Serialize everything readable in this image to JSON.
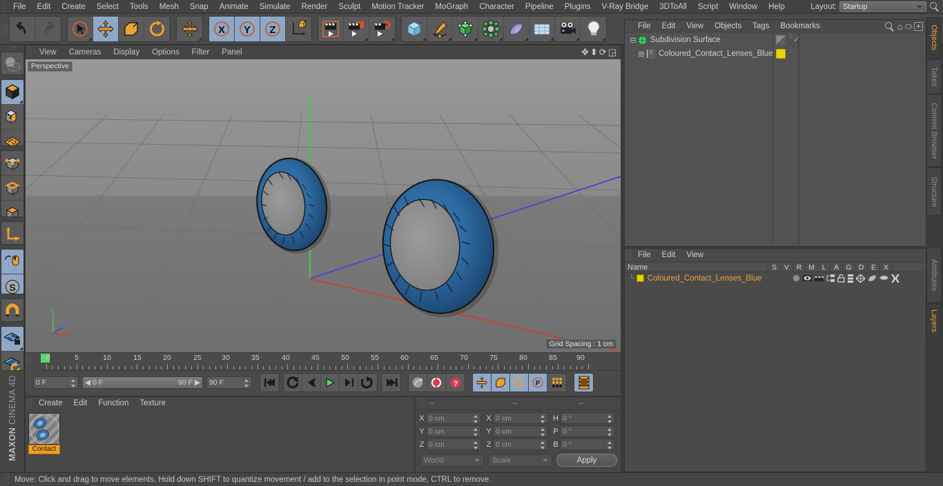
{
  "app": {
    "brand_top": "MAXON",
    "brand_bottom": "CINEMA 4D"
  },
  "menubar": {
    "items": [
      "File",
      "Edit",
      "Create",
      "Select",
      "Tools",
      "Mesh",
      "Snap",
      "Animate",
      "Simulate",
      "Render",
      "Sculpt",
      "Motion Tracker",
      "MoGraph",
      "Character",
      "Pipeline",
      "Plugins",
      "V-Ray Bridge",
      "3DToAll",
      "Script",
      "Window",
      "Help"
    ],
    "layout_label": "Layout:",
    "layout_value": "Startup",
    "search_icon": "search-icon"
  },
  "toolbar": {
    "undo": "undo-icon",
    "redo": "redo-icon",
    "select": "live-selection-icon",
    "move": "move-tool-icon",
    "scale": "scale-tool-icon",
    "rotate": "rotate-tool-icon",
    "move2": "move-axis-icon",
    "x_lock": "X",
    "y_lock": "Y",
    "z_lock": "Z",
    "world_axis": "world-object-axis-icon",
    "render_view": "render-view-icon",
    "render_region": "render-region-icon",
    "render_settings": "render-settings-icon",
    "primitive": "cube-primitive-icon",
    "spline": "pen-spline-icon",
    "generator": "generator-icon",
    "deformer": "deformer-icon",
    "scene_obj": "bend-object-icon",
    "floor": "floor-icon",
    "camera": "camera-icon",
    "light": "light-icon"
  },
  "lefttools": {
    "items": [
      {
        "name": "make-editable-icon",
        "on": false
      },
      {
        "name": "model-mode-icon",
        "on": true
      },
      {
        "name": "texture-mode-icon",
        "on": false
      },
      {
        "name": "polygon-axis-icon",
        "on": false
      },
      {
        "name": "points-mode-icon",
        "on": false
      },
      {
        "name": "edges-mode-icon",
        "on": false
      },
      {
        "name": "polygons-mode-icon",
        "on": false
      },
      {
        "name": "object-axis-icon",
        "on": false
      },
      {
        "name": "enable-snap-icon",
        "on": true
      },
      {
        "name": "soft-selection-icon",
        "on": true
      },
      {
        "name": "magnet-icon",
        "on": false
      },
      {
        "name": "lock-workplane-icon",
        "on": true
      },
      {
        "name": "workplane-rotate-icon",
        "on": false
      }
    ]
  },
  "viewport": {
    "menu": [
      "View",
      "Cameras",
      "Display",
      "Options",
      "Filter",
      "Panel"
    ],
    "view_label": "Perspective",
    "grid_spacing": "Grid Spacing : 1 cm",
    "corner_icons": [
      "pan-view-icon",
      "dolly-view-icon",
      "rotate-view-icon",
      "maximize-view-icon"
    ],
    "axis_labels": {
      "y": "Y",
      "x": "X",
      "z": "Z"
    }
  },
  "timeline": {
    "tick_labels": [
      "0",
      "5",
      "10",
      "15",
      "20",
      "25",
      "30",
      "35",
      "40",
      "45",
      "50",
      "55",
      "60",
      "65",
      "70",
      "75",
      "80",
      "85",
      "90"
    ],
    "current_frame_left": "0 F",
    "range_start": "0 F",
    "range_end": "90 F",
    "max_frame": "90 F",
    "current_frame_right": "0 F",
    "playback": [
      {
        "name": "go-to-start-button",
        "glyph": "go-to-start-icon"
      },
      {
        "name": "loop-button",
        "glyph": "loop-icon"
      },
      {
        "name": "step-back-button",
        "glyph": "previous-frame-icon"
      },
      {
        "name": "play-button",
        "glyph": "play-icon"
      },
      {
        "name": "step-forward-button",
        "glyph": "next-frame-icon"
      },
      {
        "name": "go-to-end-button",
        "glyph": "next-key-icon"
      },
      {
        "name": "go-to-last-frame-button",
        "glyph": "go-to-end-icon"
      }
    ],
    "record_tools": [
      "record-active-objects-icon",
      "autokeying-icon",
      "keyframe-selection-icon"
    ],
    "param_tools": [
      "position-key-icon",
      "scale-key-icon",
      "rotation-key-icon",
      "parameter-key-icon",
      "point-level-animation-icon"
    ],
    "timeline_toggle": "timeline-icon"
  },
  "material_manager": {
    "menu": [
      "Create",
      "Edit",
      "Function",
      "Texture"
    ],
    "materials": [
      {
        "name": "Contact",
        "thumb": "contact-lens-material-preview"
      }
    ]
  },
  "coordinates": {
    "header": [
      "--",
      "--",
      "--"
    ],
    "rows": [
      {
        "pos_label": "X",
        "pos_value": "0 cm",
        "size_label": "X",
        "size_value": "0 cm",
        "rot_label": "H",
        "rot_value": "0 °"
      },
      {
        "pos_label": "Y",
        "pos_value": "0 cm",
        "size_label": "Y",
        "size_value": "0 cm",
        "rot_label": "P",
        "rot_value": "0 °"
      },
      {
        "pos_label": "Z",
        "pos_value": "0 cm",
        "size_label": "Z",
        "size_value": "0 cm",
        "rot_label": "B",
        "rot_value": "0 °"
      }
    ],
    "coord_system": "World",
    "mode": "Scale",
    "apply_label": "Apply"
  },
  "object_manager": {
    "menu": [
      "File",
      "Edit",
      "View",
      "Objects",
      "Tags",
      "Bookmarks"
    ],
    "header_icons": [
      "search-icon",
      "home-icon",
      "ellipse-icon",
      "add-layout-icon"
    ],
    "rows": [
      {
        "label": "Subdivision Surface",
        "icon": "subdivision-surface-icon",
        "tag_icon": "phong-tag-icon",
        "check": "✓",
        "indent": 0
      },
      {
        "label": "Coloured_Contact_Lenses_Blue",
        "icon": "polygon-object-icon",
        "tag_icon": "material-tag-icon",
        "check": "",
        "indent": 1
      }
    ]
  },
  "layer_manager": {
    "menu": [
      "File",
      "Edit",
      "View"
    ],
    "columns": [
      "Name",
      "S",
      "V",
      "R",
      "M",
      "L",
      "A",
      "G",
      "D",
      "E",
      "X"
    ],
    "rows": [
      {
        "name": "Coloured_Contact_Lenses_Blue",
        "color": "#e8d400"
      }
    ]
  },
  "right_tabs": [
    {
      "label": "Objects",
      "active": true
    },
    {
      "label": "Takes",
      "active": false
    },
    {
      "label": "Content Browser",
      "active": false
    },
    {
      "label": "Structure",
      "active": false
    },
    {
      "label": "Attributes",
      "active": false
    },
    {
      "label": "Layers",
      "active": true
    }
  ],
  "status": {
    "text": "Move: Click and drag to move elements. Hold down SHIFT to quantize movement / add to the selection in point mode, CTRL to remove."
  },
  "colors": {
    "accent_orange": "#e8a33d",
    "highlight_blue": "#8fa8c8",
    "lens_blue": "#2f6fa8",
    "axis_x": "#c4423a",
    "axis_y": "#4fc14f",
    "axis_z": "#4a4ad0"
  }
}
